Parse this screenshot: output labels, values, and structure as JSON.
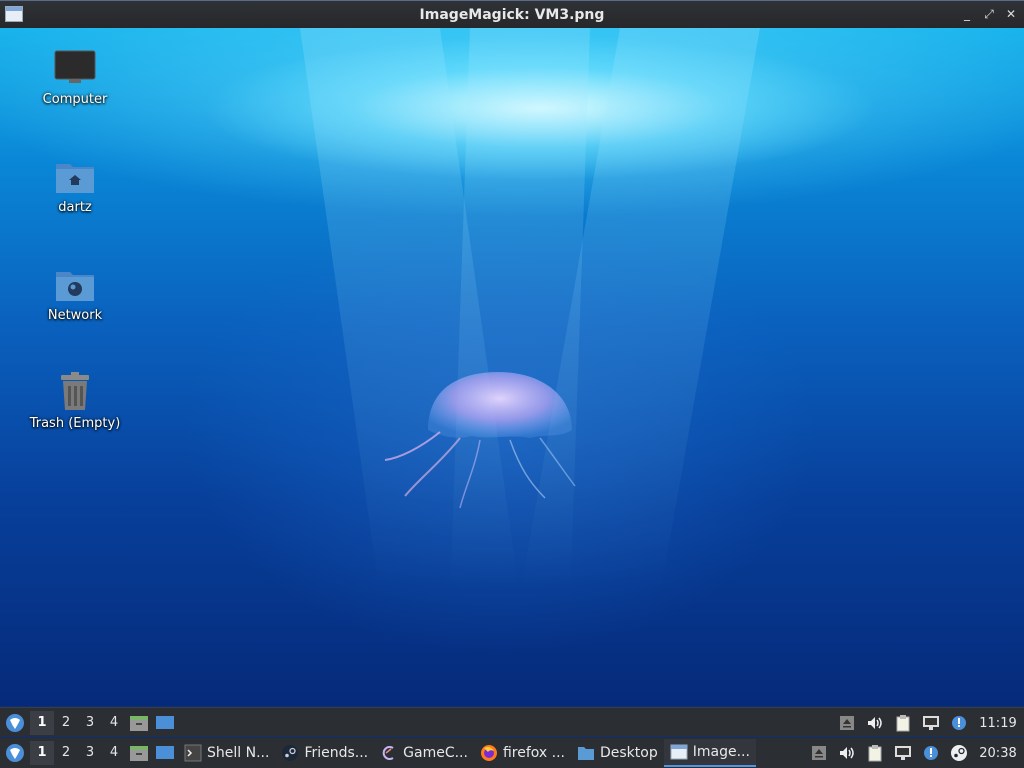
{
  "window": {
    "title": "ImageMagick: VM3.png",
    "minimize": "_",
    "maximize": "⤢",
    "close": "✕"
  },
  "desktop": {
    "icons": [
      {
        "label": "Computer"
      },
      {
        "label": "dartz"
      },
      {
        "label": "Network"
      },
      {
        "label": "Trash (Empty)"
      }
    ]
  },
  "panel_top": {
    "workspaces": [
      "1",
      "2",
      "3",
      "4"
    ],
    "active_workspace": "1",
    "clock": "11:19"
  },
  "panel_bottom": {
    "workspaces": [
      "1",
      "2",
      "3",
      "4"
    ],
    "active_workspace": "1",
    "tasks": [
      {
        "label": "Shell N...",
        "icon": "terminal-icon"
      },
      {
        "label": "Friends...",
        "icon": "steam-icon"
      },
      {
        "label": "GameC...",
        "icon": "gamecontroller-icon"
      },
      {
        "label": "firefox ...",
        "icon": "firefox-icon"
      },
      {
        "label": "Desktop",
        "icon": "folder-icon"
      },
      {
        "label": "Image...",
        "icon": "imagemagick-icon"
      }
    ],
    "clock": "20:38"
  },
  "colors": {
    "panel": "#2b2e33",
    "accent": "#5294e2",
    "folder": "#5b9bd5"
  }
}
